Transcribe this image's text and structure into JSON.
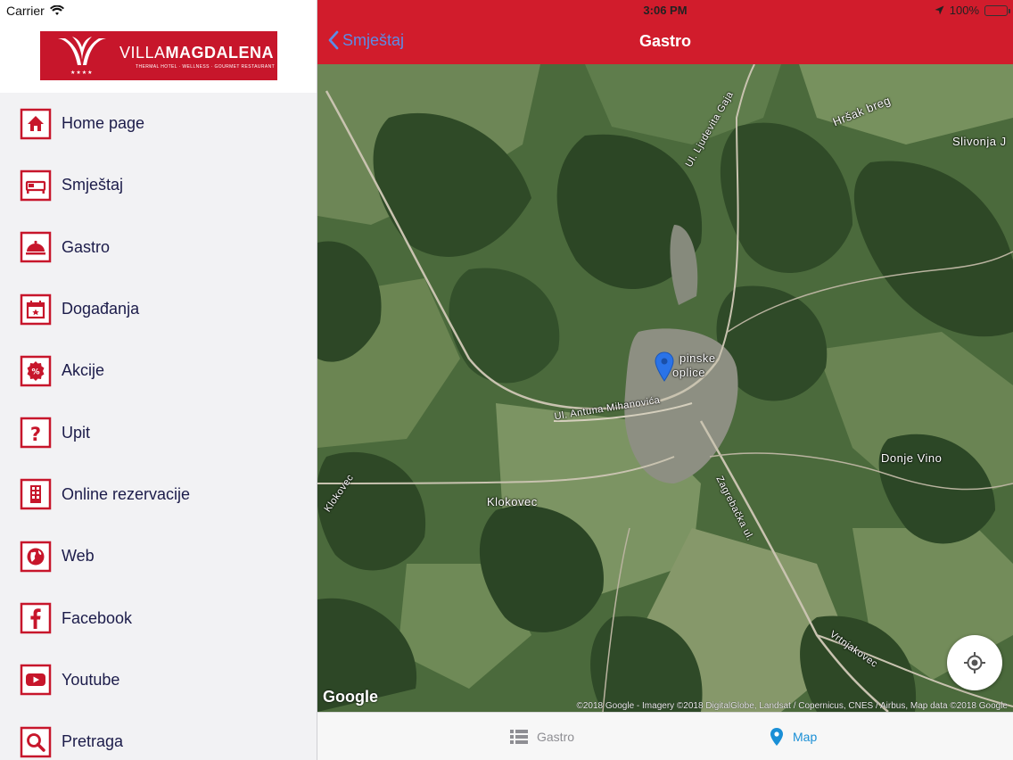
{
  "status_bar": {
    "carrier": "Carrier",
    "time": "3:06 PM",
    "battery": "100%"
  },
  "logo": {
    "brand_light": "VILLA",
    "brand_bold": "MAGDALENA",
    "tagline": "THERMAL HOTEL · WELLNESS · GOURMET RESTAURANT",
    "stars": "★★★★"
  },
  "menu": [
    {
      "label": "Home page",
      "icon": "home-icon"
    },
    {
      "label": "Smještaj",
      "icon": "bed-icon"
    },
    {
      "label": "Gastro",
      "icon": "cloche-icon"
    },
    {
      "label": "Događanja",
      "icon": "calendar-icon"
    },
    {
      "label": "Akcije",
      "icon": "discount-badge-icon"
    },
    {
      "label": "Upit",
      "icon": "question-icon"
    },
    {
      "label": "Online rezervacije",
      "icon": "building-icon"
    },
    {
      "label": "Web",
      "icon": "globe-icon"
    },
    {
      "label": "Facebook",
      "icon": "facebook-icon"
    },
    {
      "label": "Youtube",
      "icon": "youtube-icon"
    },
    {
      "label": "Pretraga",
      "icon": "search-icon"
    }
  ],
  "navbar": {
    "back_label": "Smještaj",
    "title": "Gastro"
  },
  "map": {
    "labels": {
      "hrsak_breg": "Hršak breg",
      "slivonja": "Slivonja J",
      "ljudevita_gaja": "Ul. Ljudevita Gaja",
      "krapinske_1": "pinske",
      "krapinske_2": "oplice",
      "mihanovica": "Ul. Antuna Mihanovića",
      "klokovec": "Klokovec",
      "klokovec_road": "Klokovec",
      "zagrebacka": "Zagrebačka ul.",
      "donje_vino": "Donje Vino",
      "vrtnjakovec": "Vrtnjakovec"
    },
    "logo": "Google",
    "attribution": "©2018 Google - Imagery ©2018 DigitalGlobe, Landsat / Copernicus, CNES / Airbus, Map data ©2018 Google"
  },
  "tabs": {
    "gastro": "Gastro",
    "map": "Map"
  },
  "colors": {
    "brand_red": "#d11c2c",
    "accent_blue": "#1a8fd6",
    "menu_text": "#1c1c4a"
  }
}
